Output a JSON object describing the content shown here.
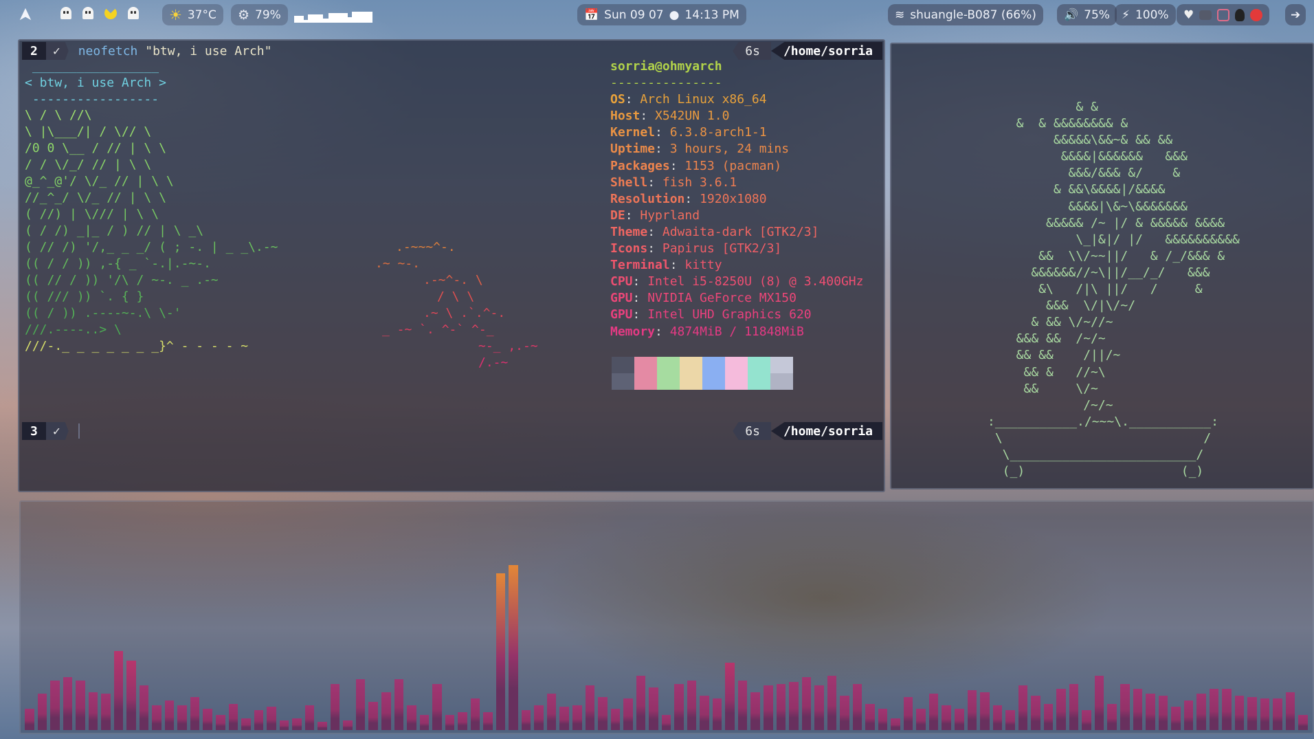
{
  "topbar": {
    "weather": "37°C",
    "cpu": "79%",
    "date": "Sun 09 07",
    "time": "14:13 PM",
    "wifi": "shuangle-B087 (66%)",
    "volume": "75%",
    "battery": "100%",
    "accent": "#e06c75"
  },
  "terminal": {
    "prompt1": {
      "num": "2",
      "status": "✓",
      "cmd_name": "neofetch",
      "cmd_arg": "\"btw, i use Arch\"",
      "duration": "6s",
      "path": "/home/sorria"
    },
    "prompt2": {
      "num": "3",
      "status": "✓",
      "duration": "6s",
      "path": "/home/sorria"
    },
    "cowsay": " _________________\n< btw, i use Arch >\n -----------------",
    "userhost": "sorria@ohmyarch",
    "separator": "---------------",
    "info": [
      {
        "label": "OS",
        "value": "Arch Linux x86_64"
      },
      {
        "label": "Host",
        "value": "X542UN 1.0"
      },
      {
        "label": "Kernel",
        "value": "6.3.8-arch1-1"
      },
      {
        "label": "Uptime",
        "value": "3 hours, 24 mins"
      },
      {
        "label": "Packages",
        "value": "1153 (pacman)"
      },
      {
        "label": "Shell",
        "value": "fish 3.6.1"
      },
      {
        "label": "Resolution",
        "value": "1920x1080"
      },
      {
        "label": "DE",
        "value": "Hyprland"
      },
      {
        "label": "Theme",
        "value": "Adwaita-dark [GTK2/3]"
      },
      {
        "label": "Icons",
        "value": "Papirus [GTK2/3]"
      },
      {
        "label": "Terminal",
        "value": "kitty"
      },
      {
        "label": "CPU",
        "value": "Intel i5-8250U (8) @ 3.400GHz"
      },
      {
        "label": "GPU",
        "value": "NVIDIA GeForce MX150"
      },
      {
        "label": "GPU",
        "value": "Intel UHD Graphics 620"
      },
      {
        "label": "Memory",
        "value": "4874MiB / 11848MiB"
      }
    ],
    "info_colors": [
      "#e9a23b",
      "#ea9a3f",
      "#eb9344",
      "#ec8b49",
      "#ed844e",
      "#ee7c53",
      "#ef7558",
      "#ef6d5d",
      "#f06662",
      "#f05e67",
      "#f0566c",
      "#ee4e72",
      "#ec4778",
      "#ea407e",
      "#e53a84"
    ],
    "palette_top": [
      "#4f5263",
      "#e48aa4",
      "#a6dca0",
      "#ecd7a8",
      "#8aaff2",
      "#f5bbdc",
      "#94e3cf",
      "#c5c8d8"
    ],
    "palette_bottom": [
      "#5e6275",
      "#e48aa4",
      "#a6dca0",
      "#ecd7a8",
      "#8aaff2",
      "#f5bbdc",
      "#94e3cf",
      "#b0b3c4"
    ]
  },
  "bonsai": {
    "tree": "          & &\n  &  & &&&&&&&& &\n       &&&&&\\&&~& && &&\n        &&&&|&&&&&&   &&&\n         &&&/&&& &/    &\n       & &&\\&&&&|/&&&&\n         &&&&|\\&~\\&&&&&&&\n      &&&&& /~ |/ & &&&&& &&&&\n          \\_|&|/ |/   &&&&&&&&&&\n     &&  \\\\/~~||/   & /_/&&& &\n    &&&&&&//~\\||/__/_/   &&&\n     &\\   /|\\ ||/   /     &\n      &&&  \\/|\\/~/\n    & && \\/~//~\n  &&& &&  /~/~\n  && &&    /||/~\n   && &   //~\\\n   &&     \\/~\n           /~/~",
    "pot": ":___________./~~~\\.___________:\n \\                           /\n  \\_________________________/\n  (_)                     (_)"
  },
  "visualizer": {
    "levels": [
      0.13,
      0.22,
      0.3,
      0.32,
      0.3,
      0.23,
      0.22,
      0.48,
      0.42,
      0.27,
      0.15,
      0.18,
      0.15,
      0.2,
      0.13,
      0.09,
      0.16,
      0.07,
      0.12,
      0.14,
      0.06,
      0.07,
      0.15,
      0.05,
      0.28,
      0.06,
      0.31,
      0.17,
      0.23,
      0.31,
      0.15,
      0.09,
      0.28,
      0.09,
      0.11,
      0.19,
      0.11,
      0.95,
      1.0,
      0.12,
      0.15,
      0.22,
      0.14,
      0.15,
      0.27,
      0.2,
      0.13,
      0.19,
      0.33,
      0.26,
      0.09,
      0.28,
      0.3,
      0.21,
      0.19,
      0.41,
      0.3,
      0.23,
      0.27,
      0.28,
      0.29,
      0.32,
      0.27,
      0.33,
      0.21,
      0.28,
      0.16,
      0.13,
      0.07,
      0.2,
      0.13,
      0.22,
      0.15,
      0.13,
      0.24,
      0.23,
      0.15,
      0.12,
      0.27,
      0.21,
      0.16,
      0.25,
      0.28,
      0.12,
      0.33,
      0.16,
      0.28,
      0.25,
      0.22,
      0.21,
      0.14,
      0.18,
      0.22,
      0.25,
      0.25,
      0.21,
      0.2,
      0.19,
      0.19,
      0.23,
      0.09
    ],
    "colors": {
      "low": "#6a2a5a",
      "mid": "#c0306a",
      "high": "#f08a30"
    }
  }
}
